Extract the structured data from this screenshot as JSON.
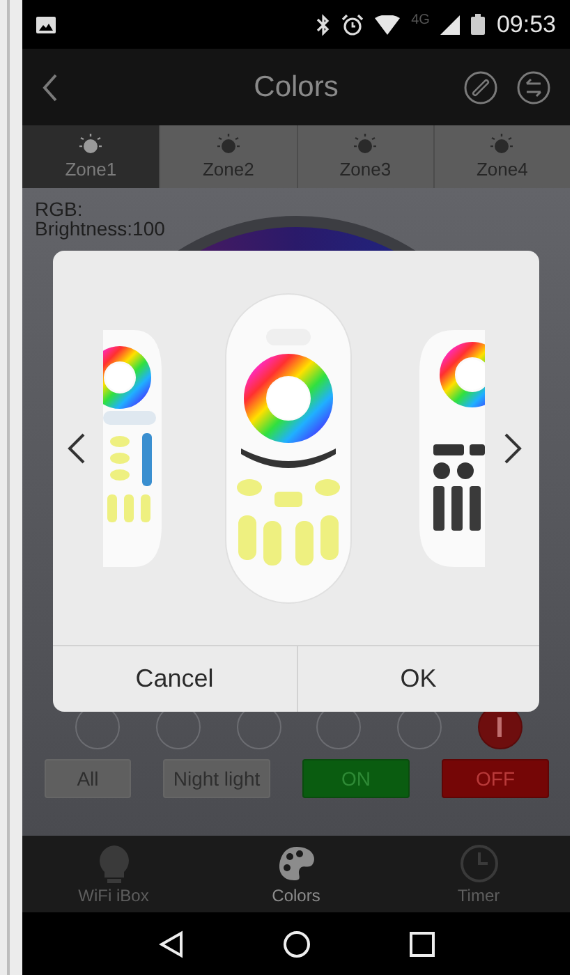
{
  "status_bar": {
    "network": "4G",
    "time": "09:53"
  },
  "app_bar": {
    "title": "Colors"
  },
  "zones": [
    {
      "label": "Zone1",
      "selected": true
    },
    {
      "label": "Zone2",
      "selected": false
    },
    {
      "label": "Zone3",
      "selected": false
    },
    {
      "label": "Zone4",
      "selected": false
    }
  ],
  "info": {
    "rgb": "RGB:",
    "brightness": "Brightness:100"
  },
  "presets": [
    {
      "kind": "empty"
    },
    {
      "kind": "empty"
    },
    {
      "kind": "empty"
    },
    {
      "kind": "empty"
    },
    {
      "kind": "empty"
    },
    {
      "kind": "add"
    }
  ],
  "actions": [
    {
      "label": "All",
      "kind": "plain"
    },
    {
      "label": "Night light",
      "kind": "plain"
    },
    {
      "label": "ON",
      "kind": "on"
    },
    {
      "label": "OFF",
      "kind": "off"
    }
  ],
  "dialog": {
    "buttons": [
      "Cancel",
      "OK"
    ]
  },
  "bottom_nav": [
    {
      "label": "WiFi iBox",
      "selected": false
    },
    {
      "label": "Colors",
      "selected": true
    },
    {
      "label": "Timer",
      "selected": false
    }
  ]
}
